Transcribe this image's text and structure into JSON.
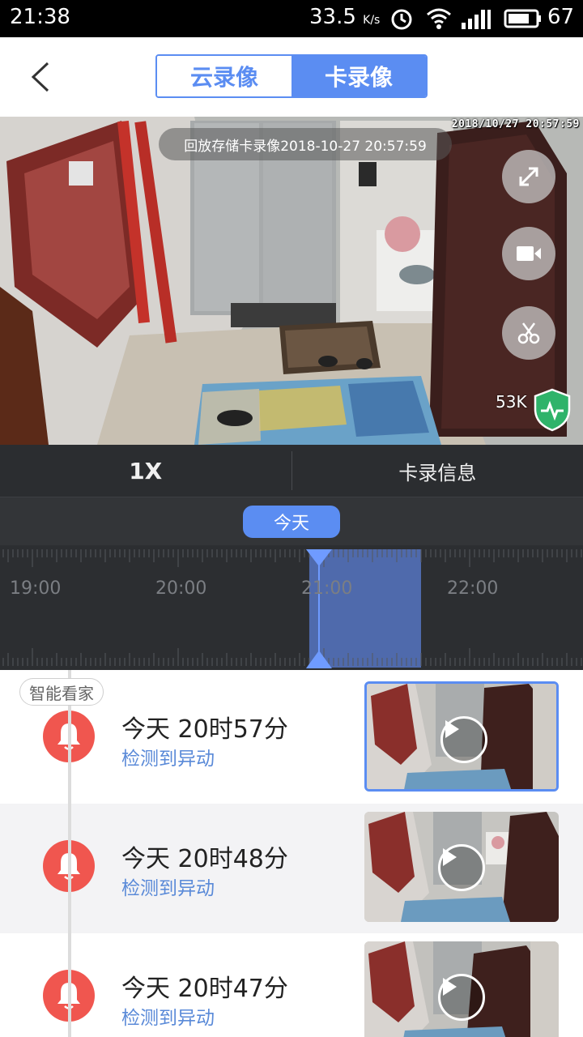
{
  "status_bar": {
    "time": "21:38",
    "net_speed": "33.5",
    "net_speed_unit": "K/s",
    "battery": "67"
  },
  "header": {
    "tabs": [
      {
        "label": "云录像",
        "active": false
      },
      {
        "label": "卡录像",
        "active": true
      }
    ]
  },
  "player": {
    "osd_timestamp": "2018/10/27 20:57:59",
    "playback_title": "回放存储卡录像2018-10-27 20:57:59",
    "bitrate": "53K",
    "controls": [
      "fullscreen-icon",
      "record-icon",
      "clip-icon"
    ]
  },
  "control_bar": {
    "speed": "1X",
    "card_info": "卡录信息"
  },
  "date_selector": {
    "label": "今天"
  },
  "timeline": {
    "labels": [
      "19:00",
      "20:00",
      "21:00",
      "22:00"
    ],
    "cursor_time": "20:57:59"
  },
  "events": {
    "group_tag": "智能看家",
    "items": [
      {
        "time": "今天 20时57分",
        "desc": "检测到异动",
        "selected": true
      },
      {
        "time": "今天 20时48分",
        "desc": "检测到异动",
        "selected": false
      },
      {
        "time": "今天 20时47分",
        "desc": "检测到异动",
        "selected": false
      }
    ]
  },
  "colors": {
    "accent": "#5b8df2",
    "alert": "#f0564f",
    "dark_bar": "#2b2d30"
  }
}
